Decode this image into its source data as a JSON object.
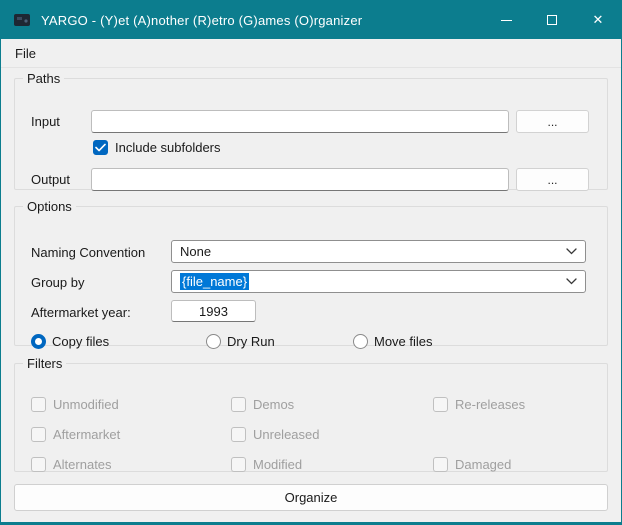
{
  "colors": {
    "titlebar": "#0c7d8e",
    "accent": "#0067c0",
    "selection": "#0078d7"
  },
  "window": {
    "title": "YARGO - (Y)et (A)nother (R)etro (G)ames (O)rganizer",
    "close_glyph": "✕"
  },
  "menu": {
    "items": [
      {
        "label": "File"
      }
    ]
  },
  "paths": {
    "legend": "Paths",
    "input_label": "Input",
    "input_value": "",
    "input_browse_label": "...",
    "include_subfolders_label": "Include subfolders",
    "include_subfolders_checked": true,
    "output_label": "Output",
    "output_value": "",
    "output_browse_label": "..."
  },
  "options": {
    "legend": "Options",
    "naming_convention_label": "Naming Convention",
    "naming_convention_value": "None",
    "group_by_label": "Group by",
    "group_by_value": "{file_name}",
    "group_by_text_selected": true,
    "aftermarket_year_label": "Aftermarket year:",
    "aftermarket_year_value": "1993",
    "radios": [
      {
        "label": "Copy files",
        "selected": true
      },
      {
        "label": "Dry Run",
        "selected": false
      },
      {
        "label": "Move files",
        "selected": false
      }
    ]
  },
  "filters": {
    "legend": "Filters",
    "items": [
      {
        "label": "Unmodified",
        "checked": false,
        "enabled": false
      },
      {
        "label": "Demos",
        "checked": false,
        "enabled": false
      },
      {
        "label": "Re-releases",
        "checked": false,
        "enabled": false
      },
      {
        "label": "Aftermarket",
        "checked": false,
        "enabled": false
      },
      {
        "label": "Unreleased",
        "checked": false,
        "enabled": false
      },
      {
        "label": "Alternates",
        "checked": false,
        "enabled": false
      },
      {
        "label": "Modified",
        "checked": false,
        "enabled": false
      },
      {
        "label": "Damaged",
        "checked": false,
        "enabled": false
      }
    ]
  },
  "organize": {
    "label": "Organize"
  }
}
